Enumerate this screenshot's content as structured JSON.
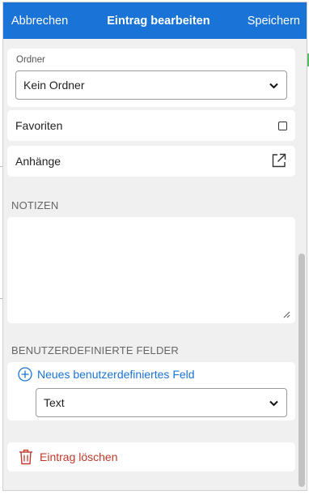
{
  "header": {
    "cancel_label": "Abbrechen",
    "title": "Eintrag bearbeiten",
    "save_label": "Speichern"
  },
  "folder": {
    "label": "Ordner",
    "selected": "Kein Ordner"
  },
  "favorites": {
    "label": "Favoriten",
    "checked": false
  },
  "attachments": {
    "label": "Anhänge",
    "icon": "external-link-icon"
  },
  "notes": {
    "section_label": "NOTIZEN",
    "value": ""
  },
  "custom_fields": {
    "section_label": "BENUTZERDEFINIERTE FELDER",
    "add_label": "Neues benutzerdefiniertes Feld",
    "type_selected": "Text"
  },
  "delete": {
    "label": "Eintrag löschen",
    "icon": "trash-icon"
  },
  "colors": {
    "accent": "#1a73d6",
    "danger": "#c0392b",
    "background": "#f0f0f0"
  }
}
